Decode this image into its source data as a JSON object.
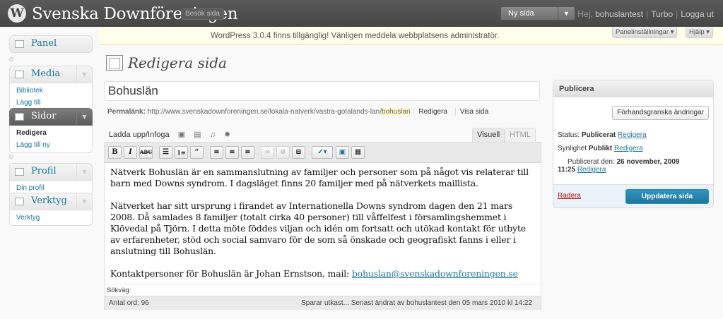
{
  "header": {
    "site_title": "Svenska Downföreningen",
    "visit_site": "Besök sida",
    "new_page": "Ny sida",
    "greeting": "Hej, ",
    "username": "bohuslantest",
    "turbo": "Turbo",
    "logout": "Logga ut"
  },
  "notice": {
    "text": "WordPress 3.0.4 finns tillgänglig! Vänligen meddela webbplatsens administratör.",
    "screen_options": "Panelinställningar",
    "help": "Hjälp"
  },
  "sidebar": {
    "panel": "Panel",
    "media": "Media",
    "media_items": [
      "Bibliotek",
      "Lägg till"
    ],
    "pages": "Sidor",
    "pages_items": [
      "Redigera",
      "Lägg till ny"
    ],
    "profile": "Profil",
    "profile_items": [
      "Din profil"
    ],
    "tools": "Verktyg",
    "tools_items": [
      "Verktyg"
    ]
  },
  "page": {
    "title": "Redigera sida",
    "post_title": "Bohuslän",
    "permalink_label": "Permalänk:",
    "permalink_base": "http://www.svenskadownforeningen.se/lokala-natverk/vastra-gotalands-lan/",
    "permalink_slug": "bohuslan",
    "edit": "Redigera",
    "view": "Visa sida"
  },
  "editor": {
    "upload_insert": "Ladda upp/Infoga",
    "tab_visual": "Visuell",
    "tab_html": "HTML",
    "paragraphs": [
      "Nätverk Bohuslän är en sammanslutning av familjer och personer som på något vis relaterar till barn med Downs syndrom. I dagsläget finns 20 familjer med på nätverkets maillista.",
      "Nätverket har sitt ursprung i firandet av Internationella Downs syndrom dagen den 21 mars 2008. Då samlades 8 familjer (totalt cirka 40 personer) till våffelfest i församlingshemmet i Klövedal på Tjörn. I detta möte föddes viljan och idén om fortsatt och utökad kontakt för utbyte av erfarenheter, stöd och social samvaro för de som så önskade och geografiskt fanns i eller i anslutning till Bohuslän."
    ],
    "contact_text": "Kontaktpersoner för Bohuslän är Johan Ernstson, mail: ",
    "contact_email": "bohuslan@svenskadownforeningen.se",
    "path_label": "Sökväg:",
    "word_count": "Antal ord: 96",
    "autosave": "Sparar utkast... Senast ändrat av bohuslantest den 05 mars 2010 kl 14:22"
  },
  "publish": {
    "heading": "Publicera",
    "preview_button": "Förhandsgranska ändringar",
    "status_label": "Status: ",
    "status_value": "Publicerat",
    "visibility_label": "Synlighet ",
    "visibility_value": "Publikt",
    "published_label": "Publicerat den: ",
    "published_date": "26 november, 2009",
    "published_time": "11:25",
    "edit": "Redigera",
    "trash": "Radera",
    "update": "Uppdatera sida"
  },
  "colors": {
    "header_bg": "#464646",
    "link": "#21759b",
    "primary_button": "#21759b",
    "notice_bg": "#fffeeb",
    "trash": "#bc0b0b"
  },
  "icons": [
    "wordpress-logo-icon",
    "panel-icon",
    "media-icon",
    "pages-icon",
    "profile-icon",
    "tools-icon",
    "page-title-icon"
  ]
}
